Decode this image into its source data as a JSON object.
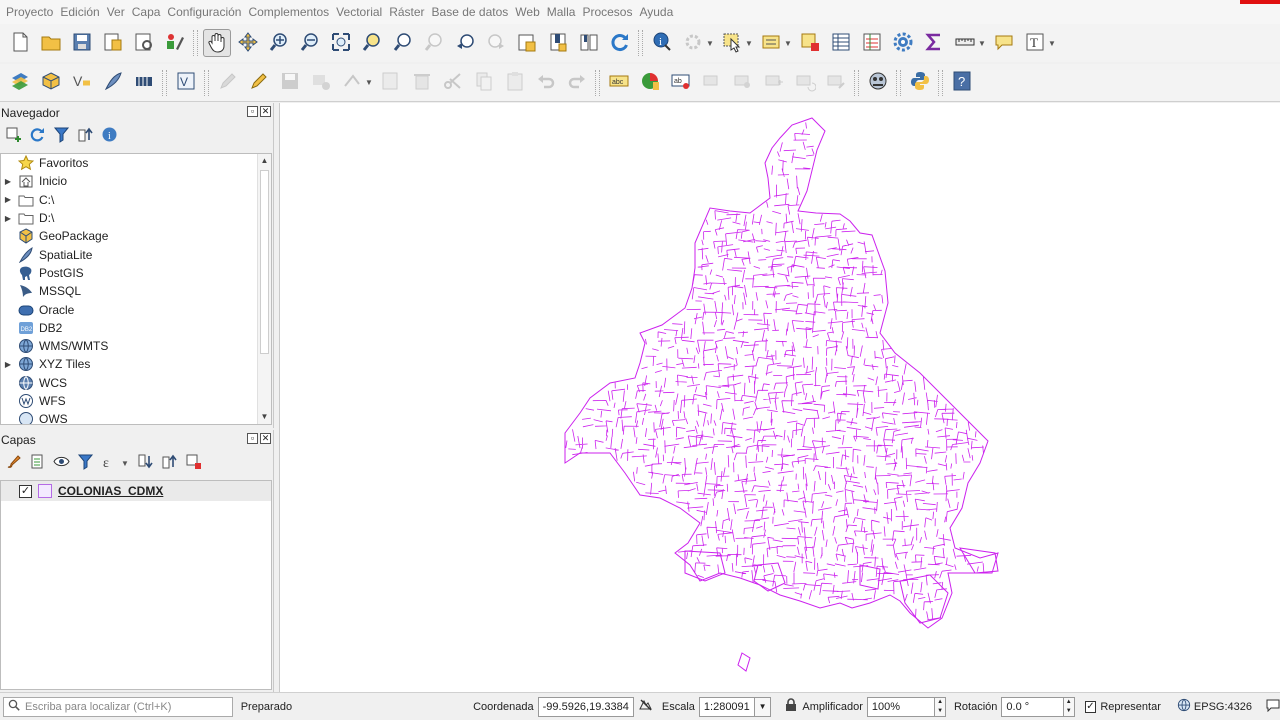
{
  "menu": [
    "Proyecto",
    "Edición",
    "Ver",
    "Capa",
    "Configuración",
    "Complementos",
    "Vectorial",
    "Ráster",
    "Base de datos",
    "Web",
    "Malla",
    "Procesos",
    "Ayuda"
  ],
  "navigator": {
    "title": "Navegador",
    "items": [
      {
        "label": "Favoritos",
        "icon": "star-icon",
        "expandable": false
      },
      {
        "label": "Inicio",
        "icon": "home-icon",
        "expandable": true
      },
      {
        "label": "C:\\",
        "icon": "folder-icon",
        "expandable": true
      },
      {
        "label": "D:\\",
        "icon": "folder-icon",
        "expandable": true
      },
      {
        "label": "GeoPackage",
        "icon": "geopackage-icon",
        "expandable": false
      },
      {
        "label": "SpatiaLite",
        "icon": "spatialite-icon",
        "expandable": false
      },
      {
        "label": "PostGIS",
        "icon": "postgis-icon",
        "expandable": false
      },
      {
        "label": "MSSQL",
        "icon": "mssql-icon",
        "expandable": false
      },
      {
        "label": "Oracle",
        "icon": "oracle-icon",
        "expandable": false
      },
      {
        "label": "DB2",
        "icon": "db2-icon",
        "expandable": false
      },
      {
        "label": "WMS/WMTS",
        "icon": "globe-icon",
        "expandable": false
      },
      {
        "label": "XYZ Tiles",
        "icon": "globe-icon",
        "expandable": true
      },
      {
        "label": "WCS",
        "icon": "globe-icon",
        "expandable": false
      },
      {
        "label": "WFS",
        "icon": "globe-icon",
        "expandable": false
      },
      {
        "label": "OWS",
        "icon": "globe-icon",
        "expandable": false
      }
    ]
  },
  "layers_panel": {
    "title": "Capas",
    "layers": [
      {
        "name": "COLONIAS_CDMX",
        "checked": true,
        "color": "#cc33ff"
      }
    ]
  },
  "map": {
    "stroke_color": "#cc22ee"
  },
  "statusbar": {
    "locator_placeholder": "Escriba para localizar (Ctrl+K)",
    "status": "Preparado",
    "coord_label": "Coordenada",
    "coord_value": "-99.5926,19.3384",
    "scale_label": "Escala",
    "scale_value": "1:280091",
    "magnifier_label": "Amplificador",
    "magnifier_value": "100%",
    "rotation_label": "Rotación",
    "rotation_value": "0.0 °",
    "render_label": "Representar",
    "crs": "EPSG:4326"
  }
}
